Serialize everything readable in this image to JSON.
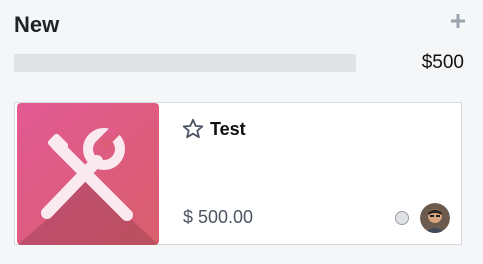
{
  "column": {
    "title": "New",
    "total": "$500",
    "add_icon": "plus-icon",
    "progress": 0
  },
  "card": {
    "name": "Test",
    "price": "$ 500.00",
    "image_icon": "tools-icon",
    "favorite_icon": "star-outline-icon",
    "status_icon": "status-circle-icon",
    "avatar_icon": "user-avatar-icon",
    "image_gradient": [
      "#e25a94",
      "#d95e6c"
    ],
    "status_color": "#dfe1e5"
  }
}
